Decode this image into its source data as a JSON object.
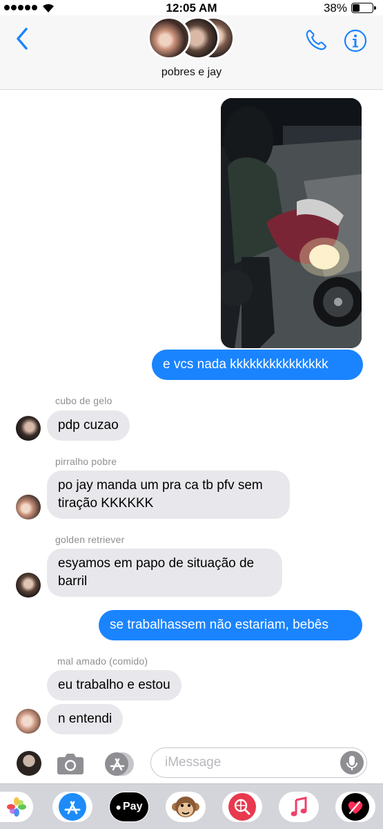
{
  "status": {
    "time": "12:05 AM",
    "battery": "38%",
    "battery_level": 0.38
  },
  "header": {
    "group_name": "pobres e jay"
  },
  "messages": {
    "outgoing_1": "e vcs nada kkkkkkkkkkkkkkk",
    "sender_1": "cubo de gelo",
    "incoming_1": "pdp cuzao",
    "sender_2": "pirralho pobre",
    "incoming_2_line1": "po jay manda um pra ca tb pfv sem",
    "incoming_2_line2": "tiração KKKKKK",
    "sender_3": "golden retriever",
    "incoming_3_line1": "esyamos em papo de situação de",
    "incoming_3_line2": "barril",
    "outgoing_2": "se trabalhassem não estariam, bebês",
    "sender_4": "mal amado (comido)",
    "incoming_4": "eu trabalho e estou",
    "incoming_5": "n entendi"
  },
  "composer": {
    "placeholder": "iMessage"
  },
  "apps": {
    "applepay_label": "Pay"
  },
  "colors": {
    "accent": "#1a84ff",
    "incoming_bubble": "#e8e8ec",
    "sender_name": "#8e8e93"
  },
  "icons": [
    "back-chevron-icon",
    "phone-icon",
    "info-icon",
    "camera-icon",
    "app-store-icon",
    "microphone-icon",
    "photos-icon",
    "apple-pay-icon",
    "monkey-emoji-icon",
    "web-search-icon",
    "music-icon",
    "digital-touch-icon"
  ]
}
